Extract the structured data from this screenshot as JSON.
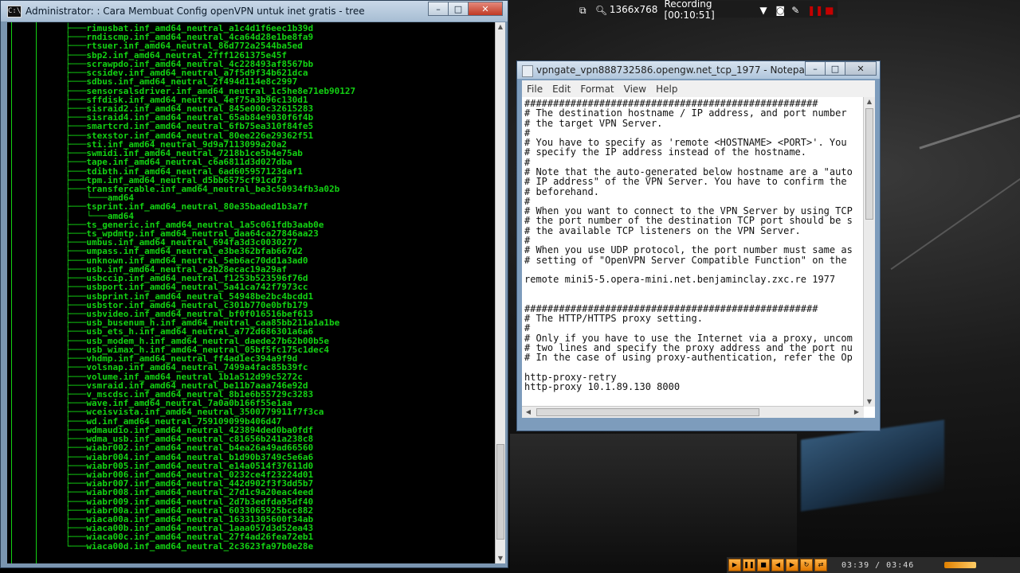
{
  "cmd": {
    "title": "Administrator:  : Cara Membuat Config openVPN untuk inet gratis - tree",
    "icon": "C:\\",
    "buttons": {
      "minimize": "–",
      "maximize": "□",
      "close": "✕"
    },
    "lines": [
      "           ├───rimusbat.inf_amd64_neutral_a1c4d1f6eec1b39d",
      "           ├───rndiscmp.inf_amd64_neutral_4ca64d28e1be8fa9",
      "           ├───rtsuer.inf_amd64_neutral_86d772a2544ba5ed",
      "           ├───sbp2.inf_amd64_neutral_2fff1261375e45f",
      "           ├───scrawpdo.inf_amd64_neutral_4c228493af8567bb",
      "           ├───scsidev.inf_amd64_neutral_a7f5d9f34b621dca",
      "           ├───sdbus.inf_amd64_neutral_2f494d114e8c2997",
      "           ├───sensorsalsdriver.inf_amd64_neutral_1c5he8e71eb90127",
      "           ├───sffdisk.inf_amd64_neutral_4ef75a3b96c130d1",
      "           ├───sisraid2.inf_amd64_neutral_845e000c32615283",
      "           ├───sisraid4.inf_amd64_neutral_65ab84e9030f6f4b",
      "           ├───smartcrd.inf_amd64_neutral_6fb75ea310f84fe5",
      "           ├───stexstor.inf_amd64_neutral_80ee226e29362f51",
      "           ├───sti.inf_amd64_neutral_9d9a7113099a20a2",
      "           ├───swmidi.inf_amd64_neutral_7218b1ce5b4e75ab",
      "           ├───tape.inf_amd64_neutral_c6a6811d3d027dba",
      "           ├───tdibth.inf_amd64_neutral_6ad605957123daf1",
      "           ├───tpm.inf_amd64_neutral_d5bb6575cf91cd73",
      "           ├───transfercable.inf_amd64_neutral_be3c50934fb3a02b",
      "           │   └───amd64",
      "           ├───tsprint.inf_amd64_neutral_80e35baded1b3a7f",
      "           │   └───amd64",
      "           ├───ts_generic.inf_amd64_neutral_1a5c061fdb3aab0e",
      "           ├───ts_wpdmtp.inf_amd64_neutral_daa64ca27846aa23",
      "           ├───umbus.inf_amd64_neutral_694fa3d3c0030277",
      "           ├───umpass.inf_amd64_neutral_e3be362bfab667d2",
      "           ├───unknown.inf_amd64_neutral_5eb6ac70dd1a3ad0",
      "           ├───usb.inf_amd64_neutral_e2b28ecac19a29af",
      "           ├───usbccip.inf_amd64_neutral_f1253b523596f76d",
      "           ├───usbport.inf_amd64_neutral_5a41ca742f7973cc",
      "           ├───usbprint.inf_amd64_neutral_54948be2bc4bcdd1",
      "           ├───usbstor.inf_amd64_neutral_c301b770e0bfb179",
      "           ├───usbvideo.inf_amd64_neutral_bf0f016516bef613",
      "           ├───usb_busenum_h.inf_amd64_neutral_caa85bb211a1a1be",
      "           ├───usb_ets_h.inf_amd64_neutral_a772d686301a6a6",
      "           ├───usb_modem_h.inf_amd64_neutral_daede27b62b00b5e",
      "           ├───usb_wimax_h.inf_amd64_neutral_05bf5fc175c1dec4",
      "           ├───vhdmp.inf_amd64_neutral_ff4ad1ec394a9f9d",
      "           ├───volsnap.inf_amd64_neutral_7499a4fac85b39fc",
      "           ├───volume.inf_amd64_neutral_1b1a512d99c5272c",
      "           ├───vsmraid.inf_amd64_neutral_be11b7aaa746e92d",
      "           ├───v_mscdsc.inf_amd64_neutral_8b1e6b55729c3283",
      "           ├───wave.inf_amd64_neutral_7a0a0b166f55e1aa",
      "           ├───wceisvista.inf_amd64_neutral_3500779911f7f3ca",
      "           ├───wd.inf_amd64_neutral_759109099b406d47",
      "           ├───wdmaudio.inf_amd64_neutral_423894ded0ba0fdf",
      "           ├───wdma_usb.inf_amd64_neutral_c81656b241a238c8",
      "           ├───wiabr002.inf_amd64_neutral_b4ea26a49ad66560",
      "           ├───wiabr004.inf_amd64_neutral_b1d90b3749c5e6a6",
      "           ├───wiabr005.inf_amd64_neutral_e14a0514f37611d0",
      "           ├───wiabr006.inf_amd64_neutral_0232ce4f23224d01",
      "           ├───wiabr007.inf_amd64_neutral_442d902f3f3dd5b7",
      "           ├───wiabr008.inf_amd64_neutral_27d1c9a20eac4eed",
      "           ├───wiabr009.inf_amd64_neutral_2d7b3edfda95df40",
      "           ├───wiabr00a.inf_amd64_neutral_6033065925bcc882",
      "           ├───wiaca00a.inf_amd64_neutral_16331305600f34ab",
      "           ├───wiaca00b.inf_amd64_neutral_1aaa057d3d52ea43",
      "           ├───wiaca00c.inf_amd64_neutral_27f4ad26fea72eb1",
      "           └───wiaca00d.inf_amd64_neutral_2c3623fa97b0e28e"
    ]
  },
  "recorder": {
    "resolution": "1366x768",
    "status": "Recording [00:10:51]"
  },
  "notepad": {
    "title": "vpngate_vpn888732586.opengw.net_tcp_1977 - Notepad",
    "menu": [
      "File",
      "Edit",
      "Format",
      "View",
      "Help"
    ],
    "buttons": {
      "minimize": "–",
      "maximize": "□",
      "close": "✕"
    },
    "lines": [
      "###################################################",
      "# The destination hostname / IP address, and port number",
      "# the target VPN Server.",
      "#",
      "# You have to specify as 'remote <HOSTNAME> <PORT>'. You",
      "# specify the IP address instead of the hostname.",
      "#",
      "# Note that the auto-generated below hostname are a \"auto",
      "# IP address\" of the VPN Server. You have to confirm the",
      "# beforehand.",
      "#",
      "# When you want to connect to the VPN Server by using TCP",
      "# the port number of the destination TCP port should be s",
      "# the available TCP listeners on the VPN Server.",
      "#",
      "# When you use UDP protocol, the port number must same as",
      "# setting of \"OpenVPN Server Compatible Function\" on the",
      "",
      "remote mini5-5.opera-mini.net.benjaminclay.zxc.re 1977",
      "",
      "",
      "###################################################",
      "# The HTTP/HTTPS proxy setting.",
      "#",
      "# Only if you have to use the Internet via a proxy, uncom",
      "# two lines and specify the proxy address and the port nu",
      "# In the case of using proxy-authentication, refer the Op",
      "",
      "http-proxy-retry",
      "http-proxy 10.1.89.130 8000"
    ]
  },
  "player": {
    "time": "03:39 / 03:46",
    "icons": [
      "play-icon",
      "pause-icon",
      "stop-icon",
      "prev-icon",
      "next-icon",
      "repeat-icon",
      "shuffle-icon"
    ]
  }
}
